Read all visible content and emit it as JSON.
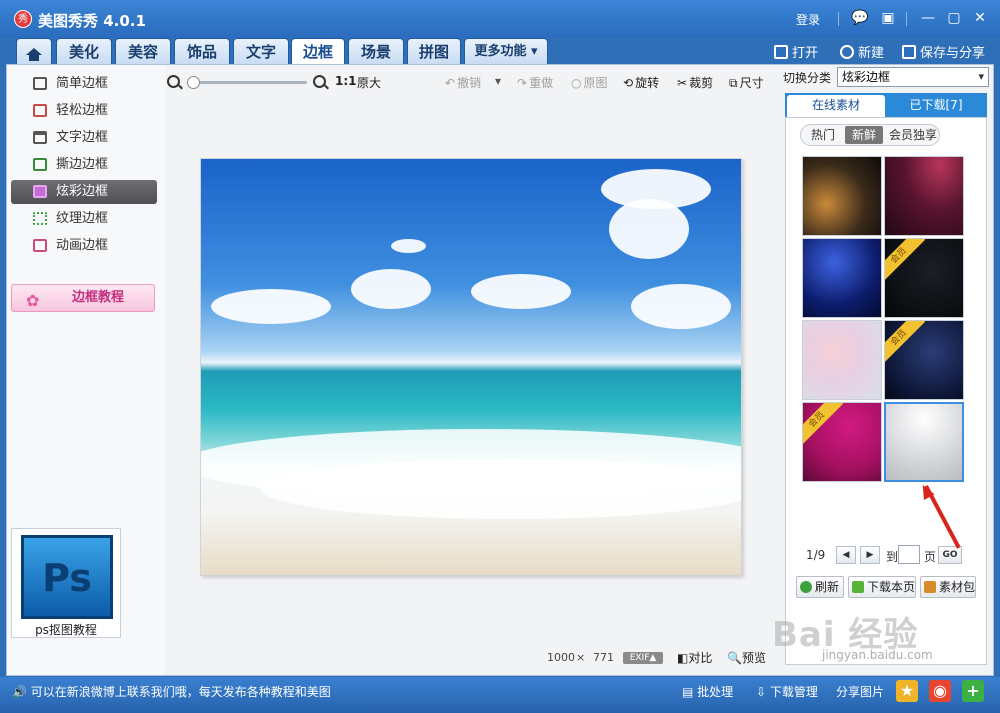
{
  "window": {
    "title": "美图秀秀 4.0.1",
    "login": "登录",
    "logo_glyph": "秀",
    "controls": [
      "💬",
      "▣",
      "—",
      "▢",
      "✕"
    ]
  },
  "tabs": [
    {
      "label": "美化"
    },
    {
      "label": "美容"
    },
    {
      "label": "饰品"
    },
    {
      "label": "文字"
    },
    {
      "label": "边框"
    },
    {
      "label": "场景"
    },
    {
      "label": "拼图"
    },
    {
      "label": "更多功能 ▾"
    }
  ],
  "active_tab": "边框",
  "header_actions": {
    "open": "打开",
    "new": "新建",
    "save_share": "保存与分享"
  },
  "sidebar": {
    "items": [
      {
        "label": "简单边框"
      },
      {
        "label": "轻松边框"
      },
      {
        "label": "文字边框"
      },
      {
        "label": "撕边边框"
      },
      {
        "label": "炫彩边框"
      },
      {
        "label": "纹理边框"
      },
      {
        "label": "动画边框"
      }
    ],
    "active": "炫彩边框",
    "tutorial_button": "边框教程",
    "ps_card": {
      "logo": "Ps",
      "label": "ps抠图教程"
    }
  },
  "toolbar": {
    "zoom_ratio": "1:1",
    "original_size": "原大",
    "undo": "撤销",
    "redo": "重做",
    "original": "原图",
    "rotate": "旋转",
    "crop": "裁剪",
    "resize": "尺寸"
  },
  "canvas_info": {
    "width": "1000",
    "times": "×",
    "height": "771",
    "exif": "EXIF▲",
    "compare": "对比",
    "preview": "预览"
  },
  "right_panel": {
    "switch_label": "切换分类",
    "category": "炫彩边框",
    "tabs": [
      "在线素材",
      "已下载[7]"
    ],
    "filters": [
      "热门",
      "新鲜",
      "会员独享"
    ],
    "active_filter": "新鲜",
    "member_ribbon": "会员",
    "pager": {
      "current": "1/9",
      "to_label": "到",
      "page_label": "页",
      "go": "GO"
    },
    "actions": {
      "refresh": "刷新",
      "download_page": "下载本页",
      "material_pack": "素材包"
    }
  },
  "statusbar": {
    "message": "可以在新浪微博上联系我们哦，每天发布各种教程和美图",
    "batch": "批处理",
    "download_manager": "下载管理",
    "share": "分享图片"
  },
  "watermark": {
    "main": "Bai 经验",
    "sub": "jingyan.baidu.com"
  },
  "colors": {
    "titlebar": "#2a6bbd",
    "active_sidebar": "#4f4f55",
    "accent": "#2a8ad8",
    "arrow": "#d9251c"
  }
}
